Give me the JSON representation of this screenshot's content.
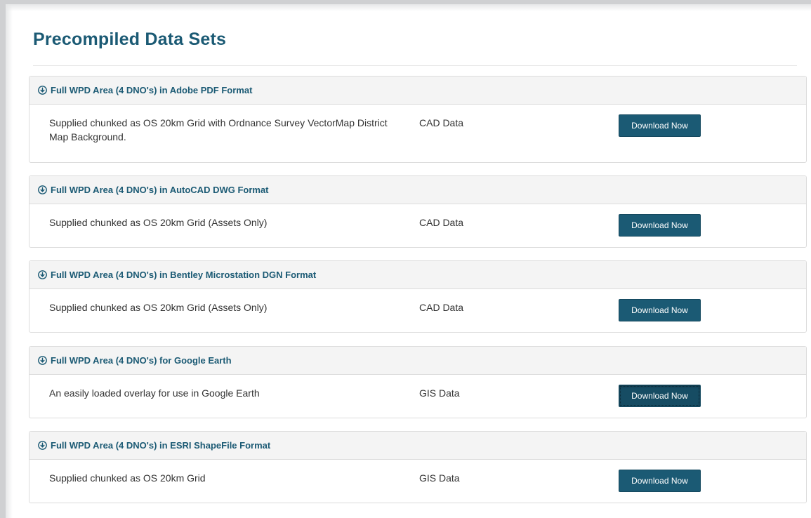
{
  "page": {
    "title": "Precompiled Data Sets"
  },
  "datasets": [
    {
      "title": "Full WPD Area (4 DNO's) in Adobe PDF Format",
      "description": "Supplied chunked as OS 20km Grid with Ordnance Survey VectorMap District Map Background.",
      "type": "CAD Data",
      "button": "Download Now"
    },
    {
      "title": "Full WPD Area (4 DNO's) in AutoCAD DWG Format",
      "description": "Supplied chunked as OS 20km Grid (Assets Only)",
      "type": "CAD Data",
      "button": "Download Now"
    },
    {
      "title": "Full WPD Area (4 DNO's) in Bentley Microstation DGN Format",
      "description": "Supplied chunked as OS 20km Grid (Assets Only)",
      "type": "CAD Data",
      "button": "Download Now"
    },
    {
      "title": "Full WPD Area (4 DNO's) for Google Earth",
      "description": "An easily loaded overlay for use in Google Earth",
      "type": "GIS Data",
      "button": "Download Now"
    },
    {
      "title": "Full WPD Area (4 DNO's) in ESRI ShapeFile Format",
      "description": "Supplied chunked as OS 20km Grid",
      "type": "GIS Data",
      "button": "Download Now"
    }
  ],
  "icons": {
    "header_icon": "circle-arrow-down-icon"
  },
  "colors": {
    "brand": "#1b5a74",
    "panel_header_bg": "#f4f4f4",
    "border": "#dcdcdc"
  }
}
